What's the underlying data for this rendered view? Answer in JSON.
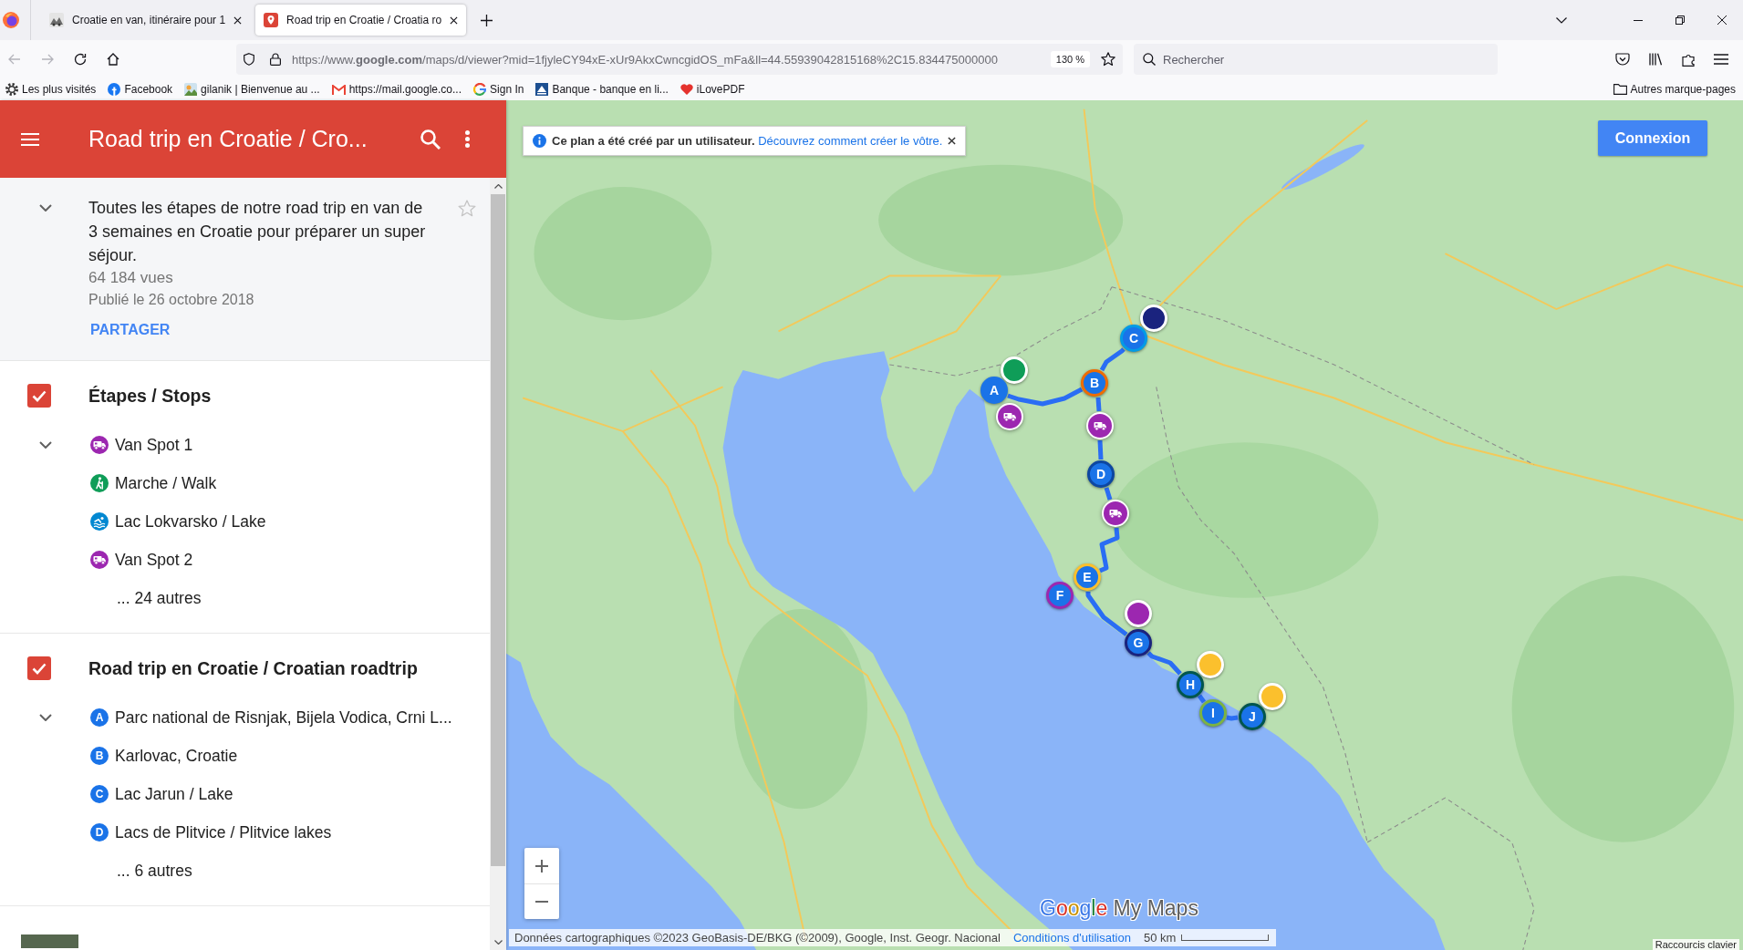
{
  "browser": {
    "tabs": [
      {
        "title": "Croatie en van, itinéraire pour 1",
        "selected": false,
        "kind": "site"
      },
      {
        "title": "Road trip en Croatie / Croatia ro",
        "selected": true,
        "kind": "map"
      }
    ],
    "navigation": {
      "back": {
        "disabled": true
      },
      "forward": {
        "disabled": true
      }
    },
    "address": {
      "url": "https://www.**google.com**/maps/d/viewer?mid=1fjyleCY94xE-xUr9AkxCwncgidOS_mFa&ll=44.55939042815168%2C15.834475000000",
      "zoom": "130 %"
    },
    "search": {
      "placeholder": "Rechercher"
    },
    "bookmarks": [
      {
        "label": "Les plus visités",
        "kind": "gear"
      },
      {
        "label": "Facebook",
        "kind": "facebook"
      },
      {
        "label": "gilanik | Bienvenue au ...",
        "kind": "picture"
      },
      {
        "label": "https://mail.google.co...",
        "kind": "mail"
      },
      {
        "label": "Sign In",
        "kind": "google"
      },
      {
        "label": "Banque - banque en li...",
        "kind": "bank"
      },
      {
        "label": "iLovePDF",
        "kind": "heart"
      }
    ],
    "other_bookmarks": "Autres marque-pages"
  },
  "panel": {
    "title": "Road trip en Croatie / Cro...",
    "description": {
      "expanded": true,
      "starred": false,
      "text": "Toutes les étapes de notre road trip en van de 3 semaines en Croatie pour préparer un super séjour.",
      "views": "64 184 vues",
      "published": "Publié le 26 octobre 2018",
      "share": "PARTAGER"
    },
    "layers": [
      {
        "title": "Étapes / Stops",
        "checked": true,
        "expanded": true,
        "items": [
          {
            "name": "Van Spot 1",
            "kind": "van",
            "color": "#9c27b0"
          },
          {
            "name": "Marche / Walk",
            "kind": "hiker",
            "color": "#0f9d58"
          },
          {
            "name": "Lac Lokvarsko / Lake",
            "kind": "swim",
            "color": "#0288d1"
          },
          {
            "name": "Van Spot 2",
            "kind": "van",
            "color": "#9c27b0"
          }
        ],
        "more": "... 24 autres"
      },
      {
        "title": "Road trip en Croatie / Croatian roadtrip",
        "checked": true,
        "expanded": true,
        "items": [
          {
            "name": "Parc national de Risnjak, Bijela Vodica, Crni L...",
            "kind": "letter",
            "marker": "A",
            "color": "#1a73e8"
          },
          {
            "name": "Karlovac, Croatie",
            "kind": "letter",
            "marker": "B",
            "color": "#1a73e8"
          },
          {
            "name": "Lac Jarun / Lake",
            "kind": "letter",
            "marker": "C",
            "color": "#1a73e8"
          },
          {
            "name": "Lacs de Plitvice / Plitvice lakes",
            "kind": "letter",
            "marker": "D",
            "color": "#1a73e8"
          }
        ],
        "more": "... 6 autres"
      }
    ]
  },
  "map": {
    "notice": {
      "text": "Ce plan a été créé par un utilisateur.",
      "link": "Découvrez comment créer le vôtre."
    },
    "sign_in": "Connexion",
    "markers": [
      {
        "kind": "pin",
        "color": "#0f9d58"
      },
      {
        "kind": "letter",
        "label": "A",
        "color": "#1a73e8"
      },
      {
        "kind": "van",
        "color": "#9c27b0"
      },
      {
        "kind": "pin",
        "color": "#1a237e"
      },
      {
        "kind": "letter",
        "label": "C",
        "color": "#039be5"
      },
      {
        "kind": "letter",
        "label": "B",
        "color": "#ef6c00"
      },
      {
        "kind": "van",
        "color": "#9c27b0"
      },
      {
        "kind": "letter",
        "label": "D",
        "color": "#0d47a1"
      },
      {
        "kind": "van",
        "color": "#9c27b0"
      },
      {
        "kind": "letter",
        "label": "E",
        "color": "#fbc02d"
      },
      {
        "kind": "letter",
        "label": "F",
        "color": "#9c27b0"
      },
      {
        "kind": "pin",
        "color": "#9c27b0"
      },
      {
        "kind": "letter",
        "label": "G",
        "color": "#1a237e"
      },
      {
        "kind": "pin",
        "color": "#fbc02d"
      },
      {
        "kind": "letter",
        "label": "H",
        "color": "#00564d"
      },
      {
        "kind": "letter",
        "label": "I",
        "color": "#7cb342"
      },
      {
        "kind": "pin",
        "color": "#fbc02d"
      },
      {
        "kind": "letter",
        "label": "J",
        "color": "#00564d"
      }
    ],
    "logo": {
      "brand": "Google",
      "product": "My Maps"
    },
    "attribution": "Données cartographiques ©2023 GeoBasis-DE/BKG (©2009), Google, Inst. Geogr. Nacional",
    "terms": "Conditions d'utilisation",
    "scale": "50 km",
    "shortcuts": "Raccourcis clavier"
  }
}
